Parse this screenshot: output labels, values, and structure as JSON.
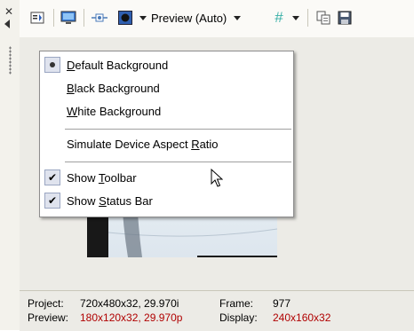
{
  "toolbar": {
    "preview_label": "Preview (Auto)",
    "icons": [
      "close-icon",
      "collapse-arrow-icon",
      "properties-icon",
      "monitor-icon",
      "split-icon",
      "background-icon",
      "grid-icon",
      "copy-icon",
      "save-icon"
    ]
  },
  "menu": {
    "items": [
      {
        "pre": "",
        "acc": "D",
        "post": "efault Background"
      },
      {
        "pre": "",
        "acc": "B",
        "post": "lack Background"
      },
      {
        "pre": "",
        "acc": "W",
        "post": "hite Background"
      },
      {
        "pre": "Simulate Device Aspect ",
        "acc": "R",
        "post": "atio"
      },
      {
        "pre": "Show ",
        "acc": "T",
        "post": "oolbar"
      },
      {
        "pre": "Show ",
        "acc": "S",
        "post": "tatus Bar"
      }
    ]
  },
  "status": {
    "project_label": "Project:",
    "project_value": "720x480x32, 29.970i",
    "preview_label": "Preview:",
    "preview_value": "180x120x32, 29.970p",
    "frame_label": "Frame:",
    "frame_value": "977",
    "display_label": "Display:",
    "display_value": "240x160x32"
  },
  "colors": {
    "status_red": "#b00000",
    "menu_border": "#8d8d8d"
  }
}
